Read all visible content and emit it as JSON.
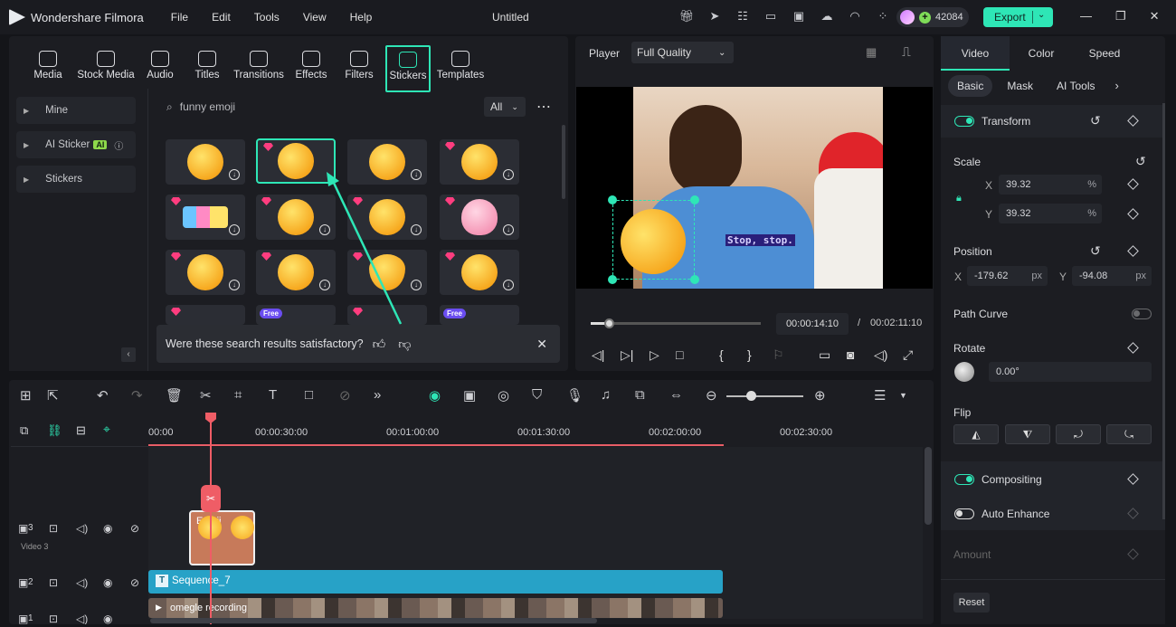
{
  "app": {
    "name": "Wondershare Filmora",
    "doc_title": "Untitled",
    "credits": "42084",
    "export_label": "Export"
  },
  "menu": [
    "File",
    "Edit",
    "Tools",
    "View",
    "Help"
  ],
  "library_tabs": [
    {
      "label": "Media",
      "icon": "media-icon"
    },
    {
      "label": "Stock Media",
      "icon": "stock-media-icon"
    },
    {
      "label": "Audio",
      "icon": "audio-icon"
    },
    {
      "label": "Titles",
      "icon": "titles-icon"
    },
    {
      "label": "Transitions",
      "icon": "transitions-icon"
    },
    {
      "label": "Effects",
      "icon": "effects-icon"
    },
    {
      "label": "Filters",
      "icon": "filters-icon"
    },
    {
      "label": "Stickers",
      "icon": "stickers-icon",
      "active": true
    },
    {
      "label": "Templates",
      "icon": "templates-icon"
    }
  ],
  "sidebar": {
    "items": [
      {
        "label": "Mine"
      },
      {
        "label": "AI Sticker",
        "badge": "AI"
      },
      {
        "label": "Stickers"
      }
    ]
  },
  "search": {
    "value": "funny emoji",
    "filter": "All"
  },
  "feedback": {
    "question": "Were these search results satisfactory?"
  },
  "player": {
    "label": "Player",
    "quality": "Full Quality",
    "current_time": "00:00:14:10",
    "separator": "/",
    "total_time": "00:02:11:10",
    "progress": 0.11,
    "caption": "Stop, stop."
  },
  "right_panel": {
    "tabs": [
      "Video",
      "Color",
      "Speed"
    ],
    "sub_tabs": [
      "Basic",
      "Mask",
      "AI Tools"
    ],
    "transform": "Transform",
    "scale": {
      "label": "Scale",
      "x_label": "X",
      "y_label": "Y",
      "x": "39.32",
      "y": "39.32",
      "unit": "%"
    },
    "position": {
      "label": "Position",
      "x_label": "X",
      "y_label": "Y",
      "x": "-179.62",
      "y": "-94.08",
      "unit": "px"
    },
    "path_curve": "Path Curve",
    "rotate": {
      "label": "Rotate",
      "value": "0.00°"
    },
    "flip": "Flip",
    "compositing": "Compositing",
    "auto_enhance": "Auto Enhance",
    "amount": "Amount",
    "reset": "Reset"
  },
  "timeline": {
    "ruler": [
      "00:00",
      "00:00:30:00",
      "00:01:00:00",
      "00:01:30:00",
      "00:02:00:00",
      "00:02:30:00"
    ],
    "tracks": [
      {
        "num": "3",
        "name": "Video 3"
      },
      {
        "num": "2"
      },
      {
        "num": "1"
      }
    ],
    "clips": {
      "sticker": "Emoji",
      "text": "Sequence_7",
      "video": "omegle recording"
    }
  }
}
